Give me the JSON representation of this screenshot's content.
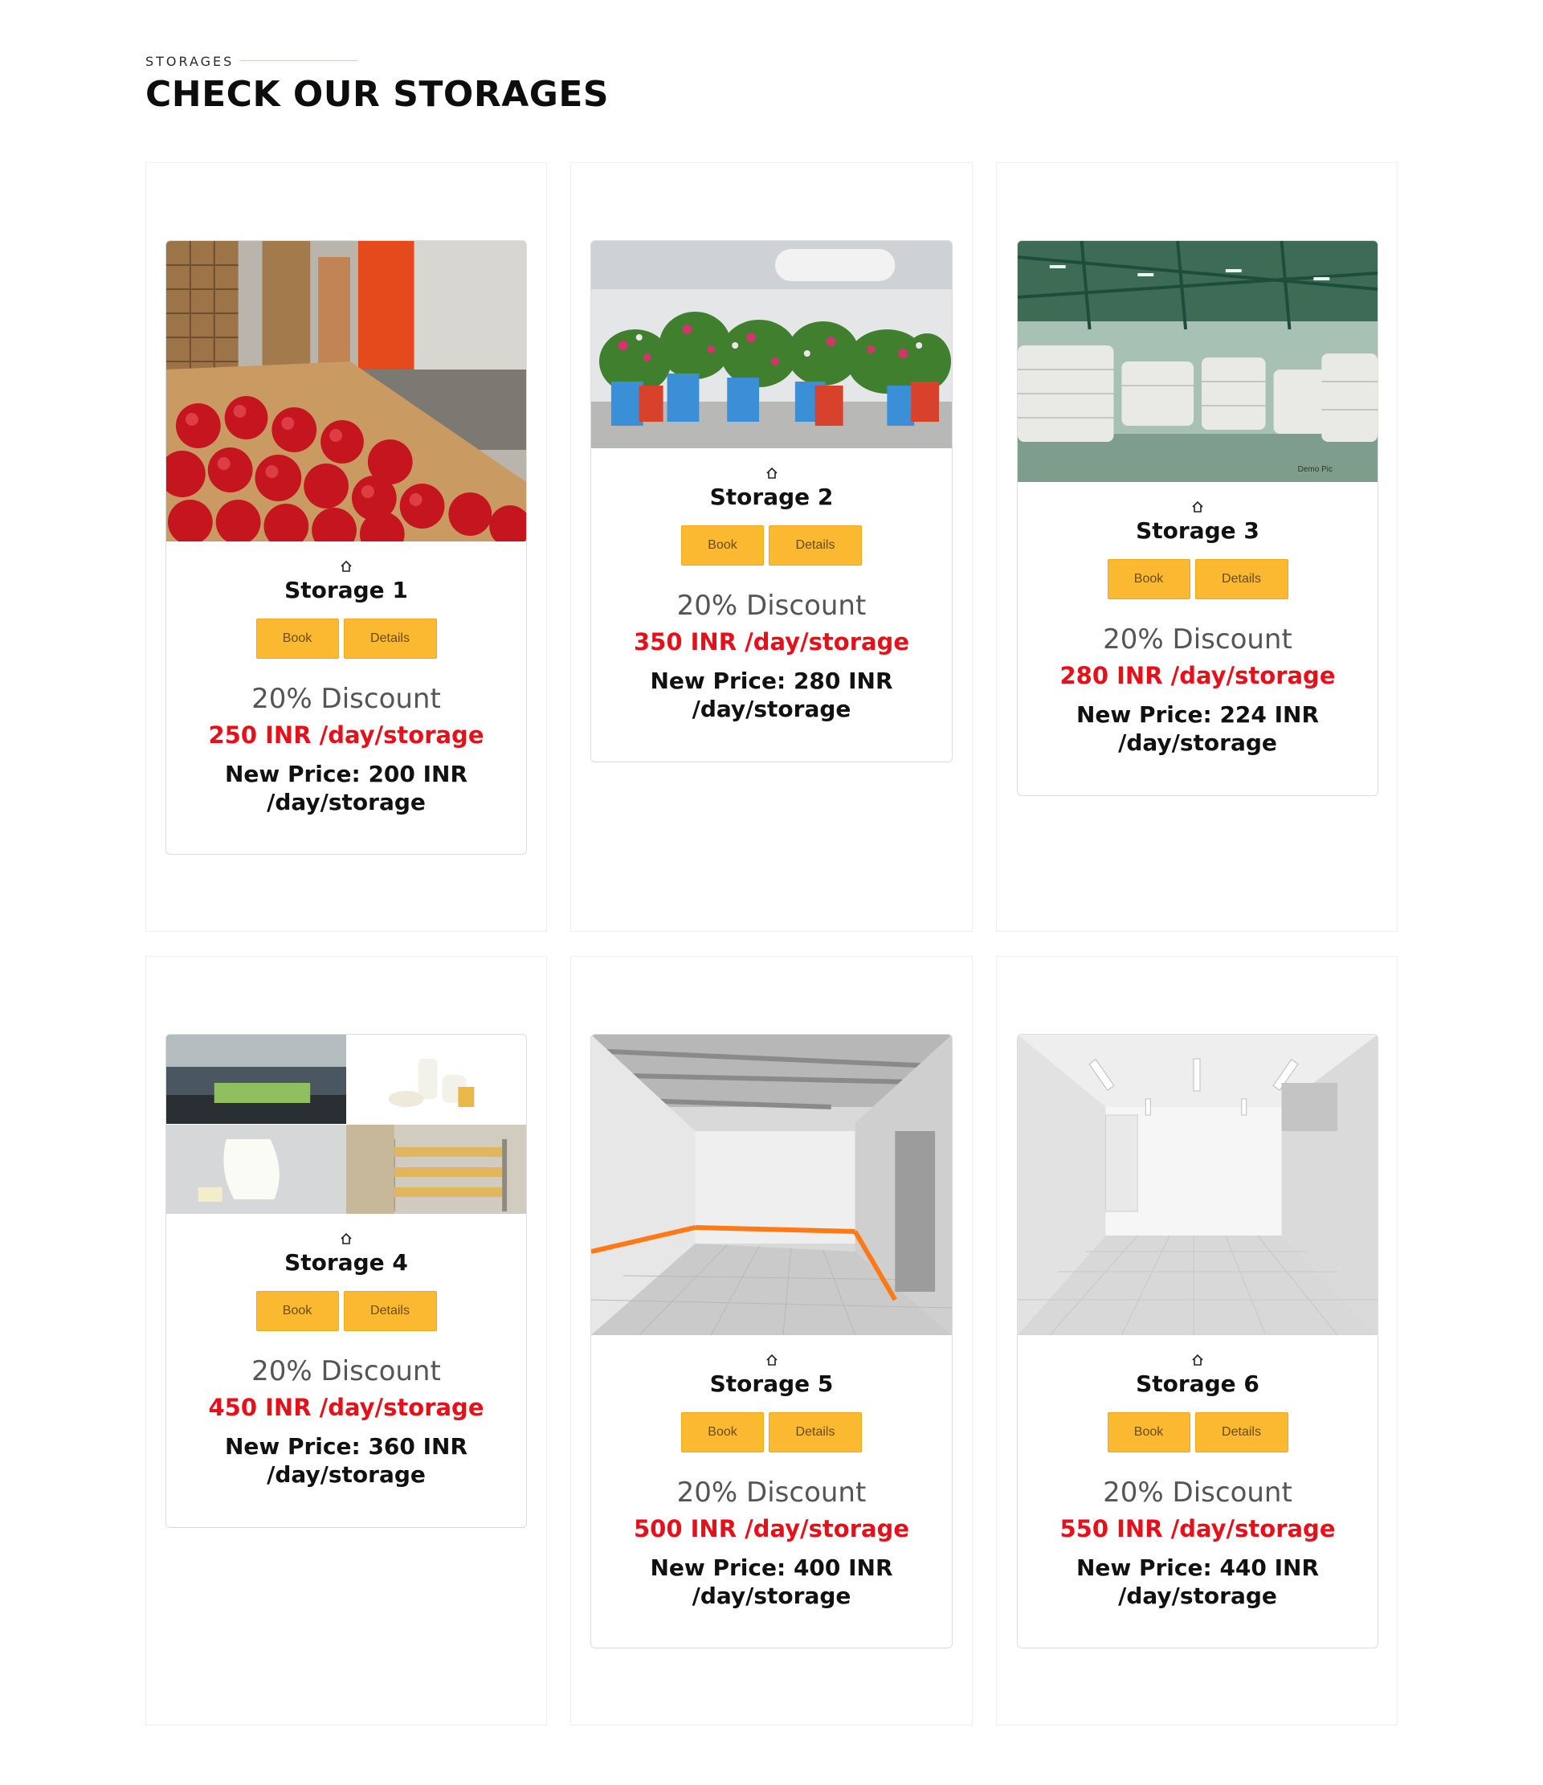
{
  "section": {
    "label": "STORAGES",
    "title": "CHECK OUR STORAGES"
  },
  "buttons": {
    "book": "Book",
    "details": "Details"
  },
  "icons": {
    "card_icon": "home-icon"
  },
  "colors": {
    "accent": "#fbb831",
    "price_red": "#e5101a"
  },
  "storages": [
    {
      "name": "Storage 1",
      "discount": "20% Discount",
      "price": "250 INR /day/storage",
      "new_price": "New Price: 200 INR /day/storage",
      "image": "apples-cold-storage"
    },
    {
      "name": "Storage 2",
      "discount": "20% Discount",
      "price": "350 INR /day/storage",
      "new_price": "New Price: 280 INR /day/storage",
      "image": "flower-pots-cold-room"
    },
    {
      "name": "Storage 3",
      "discount": "20% Discount",
      "price": "280 INR /day/storage",
      "new_price": "New Price: 224 INR /day/storage",
      "image": "grain-sacks-warehouse",
      "image_caption": "Demo Pic"
    },
    {
      "name": "Storage 4",
      "discount": "20% Discount",
      "price": "450 INR /day/storage",
      "new_price": "New Price: 360 INR /day/storage",
      "image": "dairy-collage"
    },
    {
      "name": "Storage 5",
      "discount": "20% Discount",
      "price": "500 INR /day/storage",
      "new_price": "New Price: 400 INR /day/storage",
      "image": "industrial-cold-room"
    },
    {
      "name": "Storage 6",
      "discount": "20% Discount",
      "price": "550 INR /day/storage",
      "new_price": "New Price: 440 INR /day/storage",
      "image": "empty-white-cold-room"
    }
  ]
}
